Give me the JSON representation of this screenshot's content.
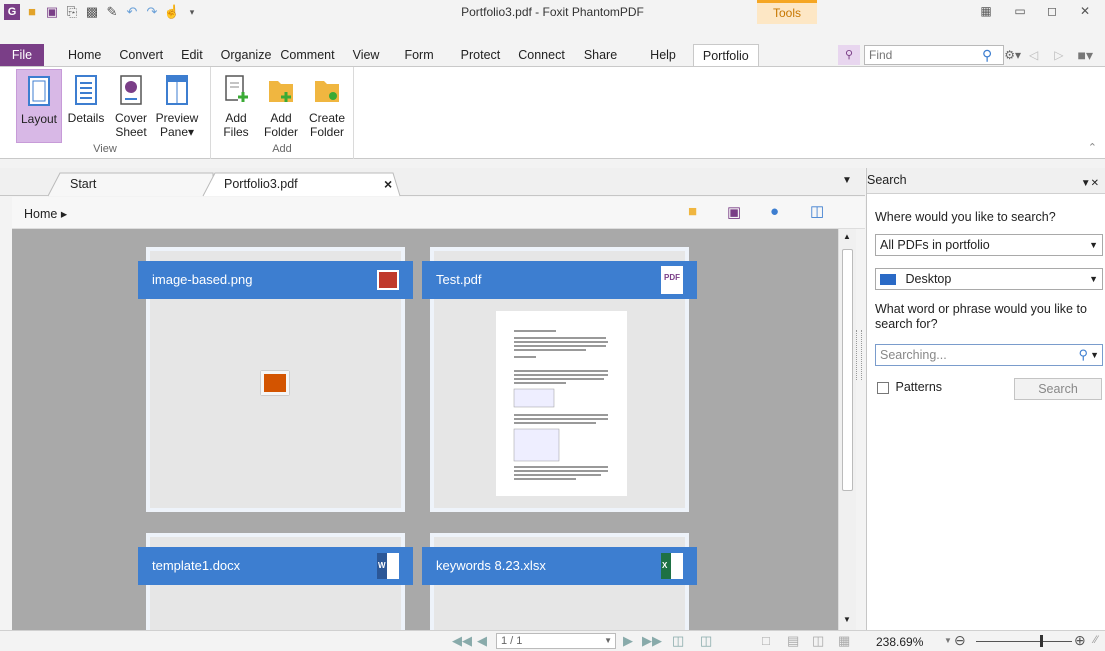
{
  "window": {
    "title": "Portfolio3.pdf - Foxit PhantomPDF",
    "context_tab": "Tools"
  },
  "ribbon_tabs": [
    "File",
    "Home",
    "Convert",
    "Edit",
    "Organize",
    "Comment",
    "View",
    "Form",
    "Protect",
    "Connect",
    "Share",
    "Help",
    "Portfolio"
  ],
  "find": {
    "placeholder": "Find"
  },
  "ribbon": {
    "view_group": {
      "label": "View",
      "buttons": [
        {
          "line1": "Layout",
          "line2": ""
        },
        {
          "line1": "Details",
          "line2": ""
        },
        {
          "line1": "Cover",
          "line2": "Sheet"
        },
        {
          "line1": "Preview",
          "line2": "Pane▾"
        }
      ]
    },
    "add_group": {
      "label": "Add",
      "buttons": [
        {
          "line1": "Add",
          "line2": "Files"
        },
        {
          "line1": "Add",
          "line2": "Folder"
        },
        {
          "line1": "Create",
          "line2": "Folder"
        }
      ]
    }
  },
  "doc_tabs": {
    "start": "Start",
    "portfolio": "Portfolio3.pdf",
    "close": "×"
  },
  "breadcrumb": {
    "home": "Home ▸"
  },
  "cards": [
    {
      "name": "image-based.png"
    },
    {
      "name": "Test.pdf"
    },
    {
      "name": "template1.docx"
    },
    {
      "name": "keywords 8.23.xlsx"
    }
  ],
  "search_pane": {
    "title": "Search",
    "question1": "Where would you like to search?",
    "scope": "All PDFs in portfolio",
    "location": "Desktop",
    "question2": "What word or phrase would you like to search for?",
    "input_placeholder": "Searching...",
    "patterns_label": "Patterns",
    "search_button": "Search"
  },
  "status": {
    "page": "1 / 1",
    "zoom": "238.69%"
  },
  "colors": {
    "accent": "#3d7ed0",
    "file_tab": "#7a3e87",
    "active_view": "#d8b8e6"
  }
}
